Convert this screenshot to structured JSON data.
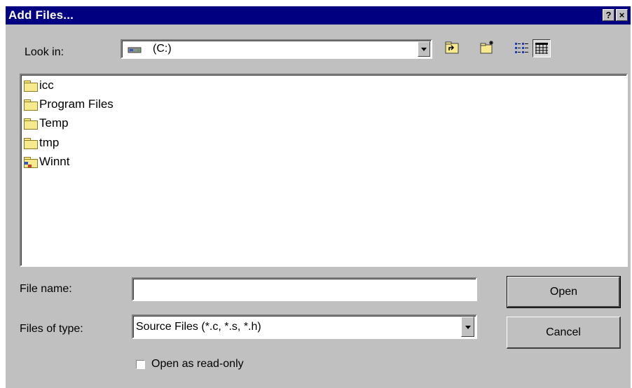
{
  "window": {
    "title": "Add Files...",
    "help_button": "?",
    "close_button": "×"
  },
  "look_in": {
    "label": "Look in:",
    "value": "(C:)"
  },
  "files": [
    {
      "name": "icc",
      "icon": "folder-icon"
    },
    {
      "name": "Program Files",
      "icon": "folder-icon"
    },
    {
      "name": "Temp",
      "icon": "folder-icon"
    },
    {
      "name": "tmp",
      "icon": "folder-icon"
    },
    {
      "name": "Winnt",
      "icon": "system-folder-icon"
    }
  ],
  "file_name": {
    "label": "File name:",
    "value": ""
  },
  "files_of_type": {
    "label": "Files of type:",
    "value": "Source Files (*.c, *.s, *.h)"
  },
  "buttons": {
    "open": "Open",
    "cancel": "Cancel"
  },
  "read_only": {
    "label": "Open as read-only",
    "checked": false
  },
  "toolbar": [
    "up-one-level-icon",
    "new-folder-icon",
    "list-view-icon",
    "details-view-icon"
  ]
}
